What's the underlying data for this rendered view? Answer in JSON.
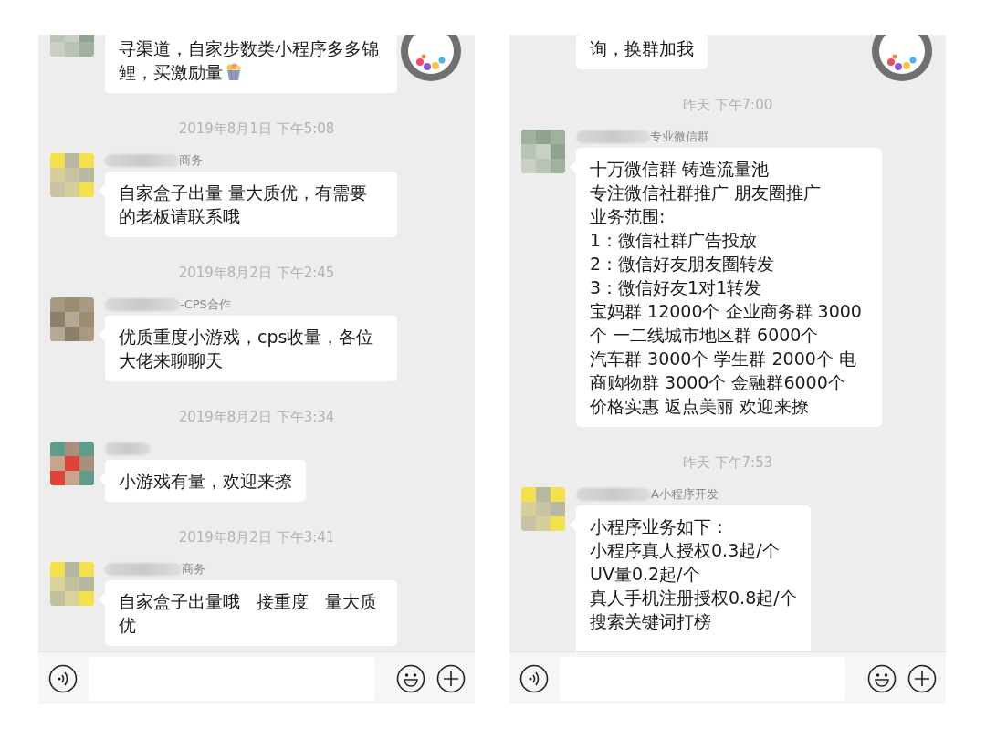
{
  "panels": [
    {
      "items": [
        {
          "kind": "cut_message",
          "avatar_visible": true,
          "lines": [
            "寻渠道，自家步数类小程序多多锦鲤，买激励量"
          ],
          "emoji": true
        },
        {
          "kind": "time",
          "text": "2019年8月1日 下午5:08"
        },
        {
          "kind": "message",
          "sender": "商务",
          "lines": [
            "自家盒子出量 量大质优，有需要的老板请联系哦"
          ]
        },
        {
          "kind": "time",
          "text": "2019年8月2日 下午2:45"
        },
        {
          "kind": "message",
          "sender": "-CPS合作",
          "lines": [
            "优质重度小游戏，cps收量，各位大佬来聊聊天"
          ]
        },
        {
          "kind": "time",
          "text": "2019年8月2日 下午3:34"
        },
        {
          "kind": "message",
          "lines": [
            "小游戏有量，欢迎来撩"
          ]
        },
        {
          "kind": "time",
          "text": "2019年8月2日 下午3:41"
        },
        {
          "kind": "message",
          "sender": "商务",
          "lines": [
            "自家盒子出量哦   接重度   量大质优"
          ]
        }
      ]
    },
    {
      "items": [
        {
          "kind": "cut_message",
          "avatar_visible": false,
          "lines": [
            "询，换群加我"
          ]
        },
        {
          "kind": "time",
          "text": "昨天 下午7:00"
        },
        {
          "kind": "message",
          "sender": "专业微信群",
          "lines": [
            "十万微信群 铸造流量池",
            "专注微信社群推广 朋友圈推广",
            "业务范围:",
            "1：微信社群广告投放",
            "2：微信好友朋友圈转发",
            "3：微信好友1对1转发",
            "宝妈群 12000个 企业商务群 3000个 一二线城市地区群 6000个",
            "汽车群 3000个 学生群 2000个 电商购物群 3000个 金融群6000个",
            "价格实惠 返点美丽 欢迎来撩"
          ]
        },
        {
          "kind": "time",
          "text": "昨天 下午7:53"
        },
        {
          "kind": "message",
          "sender": "A小程序开发",
          "lines": [
            "小程序业务如下：",
            "小程序真人授权0.3起/个",
            "UV量0.2起/个",
            "真人手机注册授权0.8起/个",
            "搜索关键词打榜"
          ]
        }
      ]
    }
  ]
}
